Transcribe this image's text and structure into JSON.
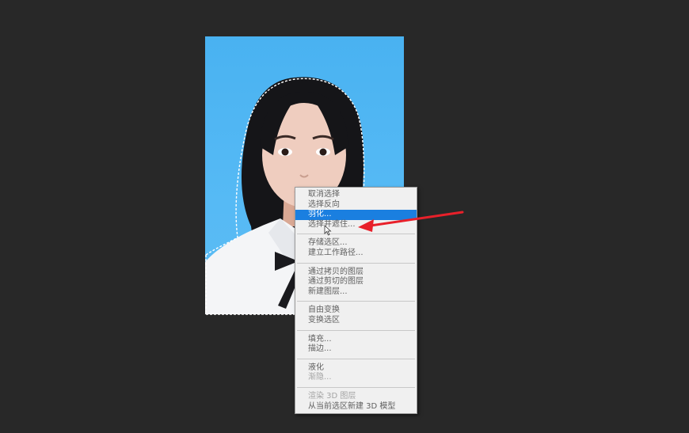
{
  "colors": {
    "canvas_bg": "#282828",
    "photo_bg": "#52b8f4",
    "menu_bg": "#f0f0f0",
    "menu_highlight": "#1a7fe0",
    "annotation_arrow": "#e8202a"
  },
  "icons": {
    "cursor": "cursor-arrow-icon",
    "annotation": "red-arrow-icon"
  },
  "context_menu": {
    "groups": [
      [
        {
          "label": "取消选择",
          "state": "enabled"
        },
        {
          "label": "选择反向",
          "state": "enabled"
        },
        {
          "label": "羽化...",
          "state": "highlighted"
        },
        {
          "label": "选择并遮住...",
          "state": "enabled"
        }
      ],
      [
        {
          "label": "存储选区...",
          "state": "enabled"
        },
        {
          "label": "建立工作路径...",
          "state": "enabled"
        }
      ],
      [
        {
          "label": "通过拷贝的图层",
          "state": "enabled"
        },
        {
          "label": "通过剪切的图层",
          "state": "enabled"
        },
        {
          "label": "新建图层...",
          "state": "enabled"
        }
      ],
      [
        {
          "label": "自由变换",
          "state": "enabled"
        },
        {
          "label": "变换选区",
          "state": "enabled"
        }
      ],
      [
        {
          "label": "填充...",
          "state": "enabled"
        },
        {
          "label": "描边...",
          "state": "enabled"
        }
      ],
      [
        {
          "label": "液化",
          "state": "enabled"
        },
        {
          "label": "渐隐...",
          "state": "disabled"
        }
      ],
      [
        {
          "label": "渲染 3D 图层",
          "state": "disabled"
        },
        {
          "label": "从当前选区新建 3D 模型",
          "state": "enabled"
        }
      ]
    ]
  }
}
